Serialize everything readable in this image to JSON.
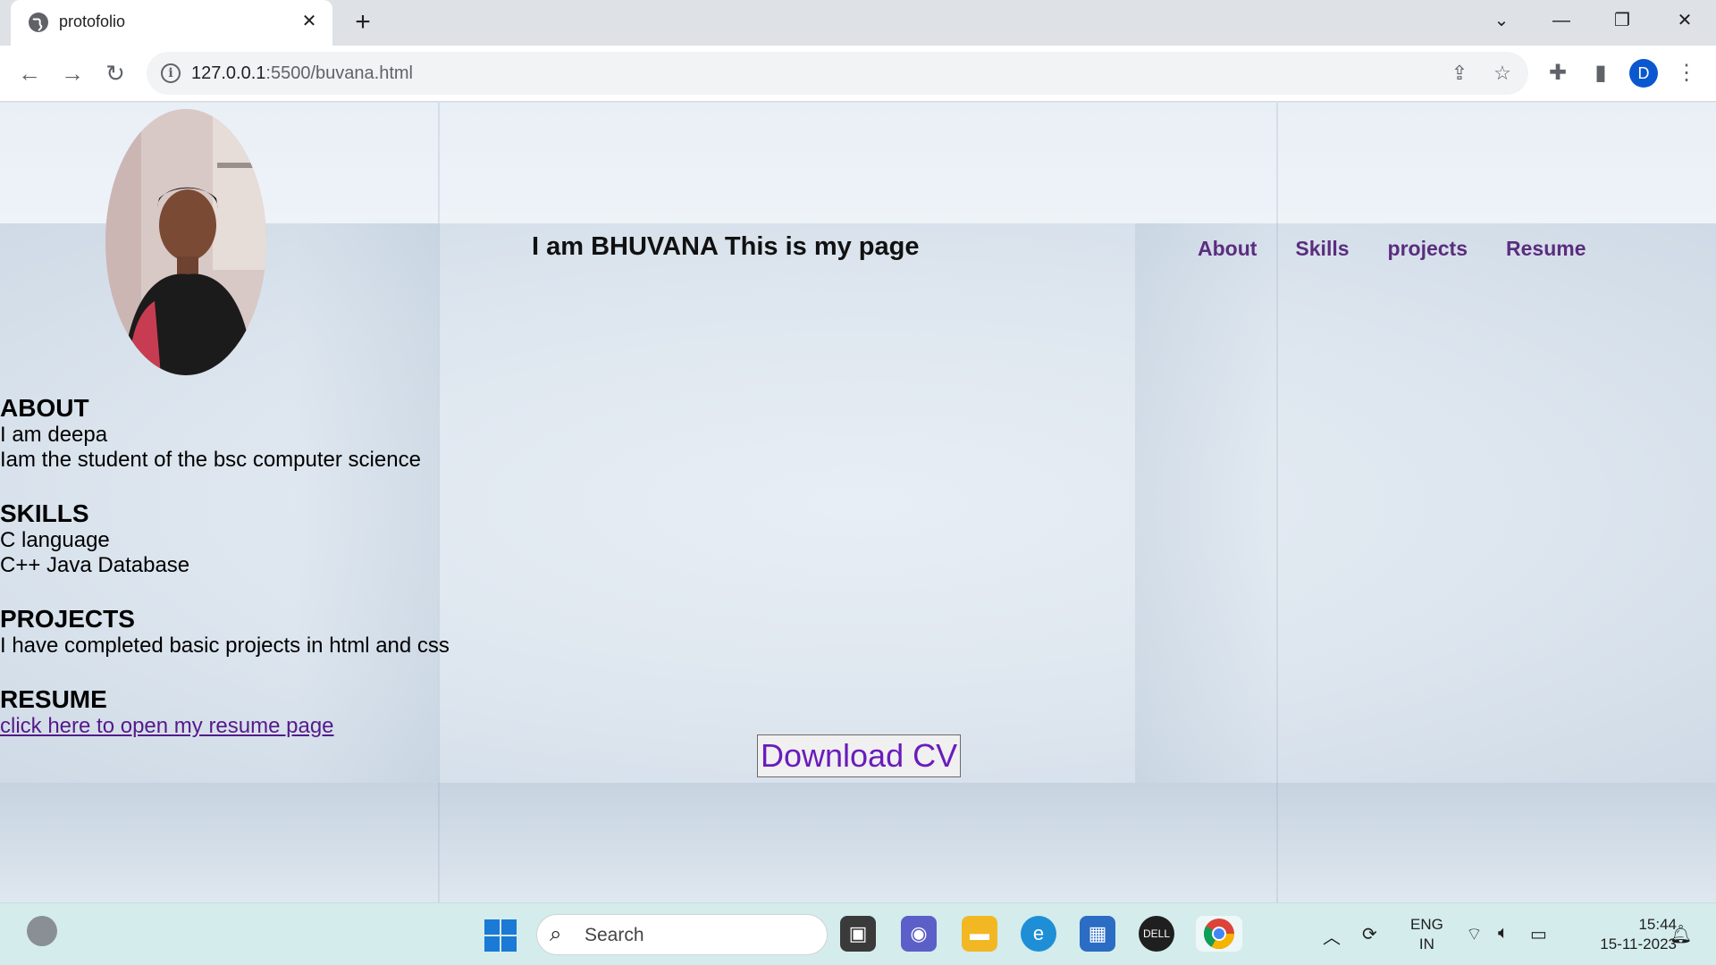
{
  "browser": {
    "tab_title": "protofolio",
    "tab_close": "✕",
    "new_tab": "+",
    "url_host": "127.0.0.1",
    "url_path": ":5500/buvana.html",
    "profile_initial": "D",
    "window_controls": {
      "dropdown": "⌄",
      "minimize": "—",
      "restore": "❐",
      "close": "✕"
    }
  },
  "page": {
    "heading": "I am BHUVANA This is my page",
    "nav": [
      "About",
      "Skills",
      "projects",
      "Resume"
    ],
    "about": {
      "title": "ABOUT",
      "lines": [
        "I am deepa",
        "Iam the student of the bsc computer science"
      ]
    },
    "skills": {
      "title": "SKILLS",
      "lines": [
        "C language",
        "C++ Java Database"
      ]
    },
    "projects": {
      "title": "PROJECTS",
      "lines": [
        "I have completed basic projects in html and css"
      ]
    },
    "resume": {
      "title": "RESUME",
      "link": "click here to open my resume page"
    },
    "download_button": "Download CV",
    "link_color": "#5b2d7e",
    "button_text_color": "#6a1bbd"
  },
  "taskbar": {
    "search_placeholder": "Search",
    "lang_top": "ENG",
    "lang_bottom": "IN",
    "time": "15:44",
    "date": "15-11-2023",
    "apps": [
      "task-view",
      "teams-chat",
      "file-explorer",
      "edge",
      "microsoft-store",
      "dell",
      "chrome"
    ]
  }
}
